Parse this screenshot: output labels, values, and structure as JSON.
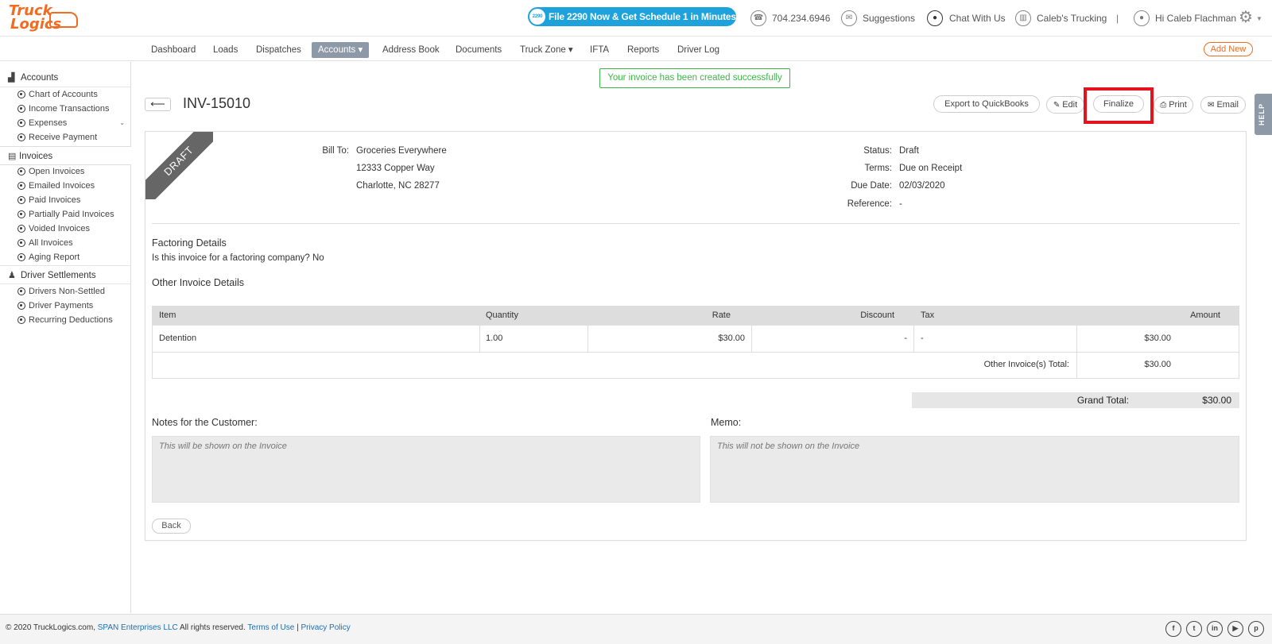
{
  "brand": {
    "logo_line1": "Truck",
    "logo_line2": "Logics",
    "accent": "#f26b21"
  },
  "topbar": {
    "promo": "File 2290 Now & Get Schedule 1 in Minutes",
    "promo_icon_text": "2290",
    "phone": "704.234.6946",
    "suggestions": "Suggestions",
    "chat": "Chat With Us",
    "company": "Caleb's Trucking",
    "separator": "|",
    "greeting": "Hi Caleb Flachman"
  },
  "nav": {
    "items": [
      "Dashboard",
      "Loads",
      "Dispatches",
      "Accounts ▾",
      "Address Book",
      "Documents",
      "Truck Zone ▾",
      "IFTA",
      "Reports",
      "Driver Log"
    ],
    "add_new": "Add New"
  },
  "sidebar": {
    "accounts": "Accounts",
    "accounts_items": [
      "Chart of Accounts",
      "Income Transactions",
      "Expenses",
      "Receive Payment"
    ],
    "invoices": "Invoices",
    "invoice_items": [
      "Open Invoices",
      "Emailed Invoices",
      "Paid Invoices",
      "Partially Paid Invoices",
      "Voided Invoices",
      "All Invoices",
      "Aging Report"
    ],
    "driver_settlements": "Driver Settlements",
    "driver_items": [
      "Drivers Non-Settled",
      "Driver Payments",
      "Recurring Deductions"
    ]
  },
  "flash": "Your invoice has been created successfully",
  "invoice": {
    "number": "INV-15010",
    "ribbon": "DRAFT",
    "actions": {
      "export": "Export to QuickBooks",
      "edit": "Edit",
      "finalize": "Finalize",
      "print": "Print",
      "email": "Email"
    },
    "help": "HELP",
    "bill_to_label": "Bill To:",
    "bill_to": [
      "Groceries Everywhere",
      "12333 Copper Way",
      "Charlotte, NC 28277"
    ],
    "meta": [
      {
        "label": "Status:",
        "value": "Draft"
      },
      {
        "label": "Terms:",
        "value": "Due on Receipt"
      },
      {
        "label": "Due Date:",
        "value": "02/03/2020"
      },
      {
        "label": "Reference:",
        "value": "-"
      }
    ],
    "factoring_title": "Factoring Details",
    "factoring_text": "Is this invoice for a factoring company? No",
    "other_title": "Other Invoice Details",
    "table": {
      "headers": [
        "Item",
        "Quantity",
        "Rate",
        "Discount",
        "Tax",
        "Amount"
      ],
      "row": [
        "Detention",
        "1.00",
        "$30.00",
        "-",
        "-",
        "$30.00"
      ],
      "subtotal_label": "Other Invoice(s) Total:",
      "subtotal_value": "$30.00"
    },
    "grand_total_label": "Grand Total:",
    "grand_total_value": "$30.00",
    "notes_label": "Notes for the Customer:",
    "notes_placeholder": "This will be shown on the Invoice",
    "memo_label": "Memo:",
    "memo_placeholder": "This will not be shown on the Invoice",
    "back": "Back"
  },
  "footer": {
    "copyright": "© 2020 TruckLogics.com,",
    "span": "SPAN Enterprises LLC",
    "rights": "All rights reserved.",
    "terms": "Terms of Use",
    "sep": "|",
    "privacy": "Privacy Policy",
    "social": [
      "f",
      "t",
      "in",
      "▶",
      "p"
    ]
  }
}
